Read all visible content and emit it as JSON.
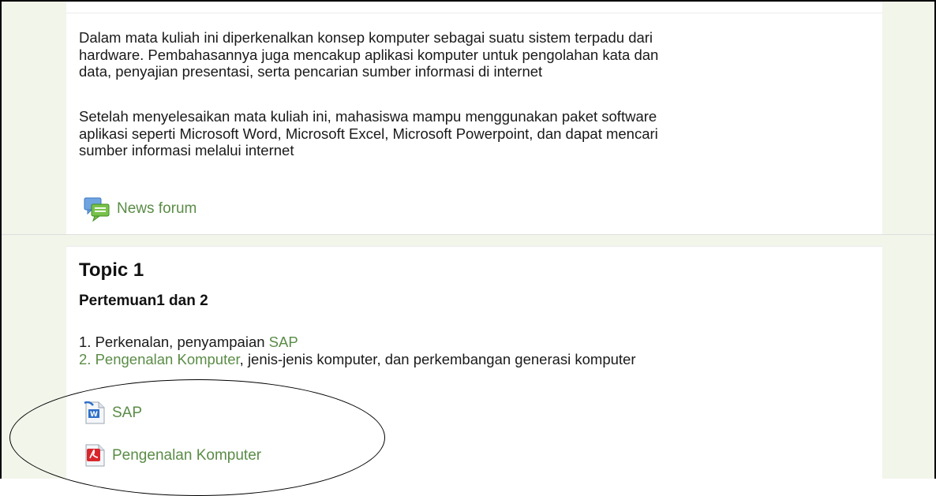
{
  "summary": {
    "paragraph1": "Dalam mata kuliah ini diperkenalkan konsep komputer  sebagai  suatu sistem terpadu dari\nhardware. Pembahasannya juga mencakup aplikasi komputer untuk pengolahan kata dan\ndata, penyajian presentasi, serta pencarian sumber informasi  di internet",
    "paragraph2": "Setelah menyelesaikan mata kuliah ini, mahasiswa mampu menggunakan paket software\naplikasi seperti Microsoft Word, Microsoft Excel, Microsoft  Powerpoint, dan  dapat mencari\nsumber informasi melalui  internet",
    "news_forum": {
      "label": "News forum",
      "icon": "forum-icon"
    }
  },
  "topic": {
    "title": "Topic 1",
    "subtitle": "Pertemuan1 dan 2",
    "items": [
      {
        "prefix": "1. Perkenalan, penyampaian ",
        "link": "SAP",
        "suffix": ""
      },
      {
        "num": "2. ",
        "link": "Pengenalan Komputer",
        "suffix": ", jenis-jenis komputer, dan perkembangan generasi komputer"
      }
    ],
    "resources": [
      {
        "label": "SAP",
        "icon": "word-document-icon"
      },
      {
        "label": "Pengenalan Komputer",
        "icon": "pdf-document-icon"
      }
    ]
  },
  "colors": {
    "link": "#5a8c46",
    "sidebar": "#f1f5ea",
    "text": "#1a1a1a"
  }
}
